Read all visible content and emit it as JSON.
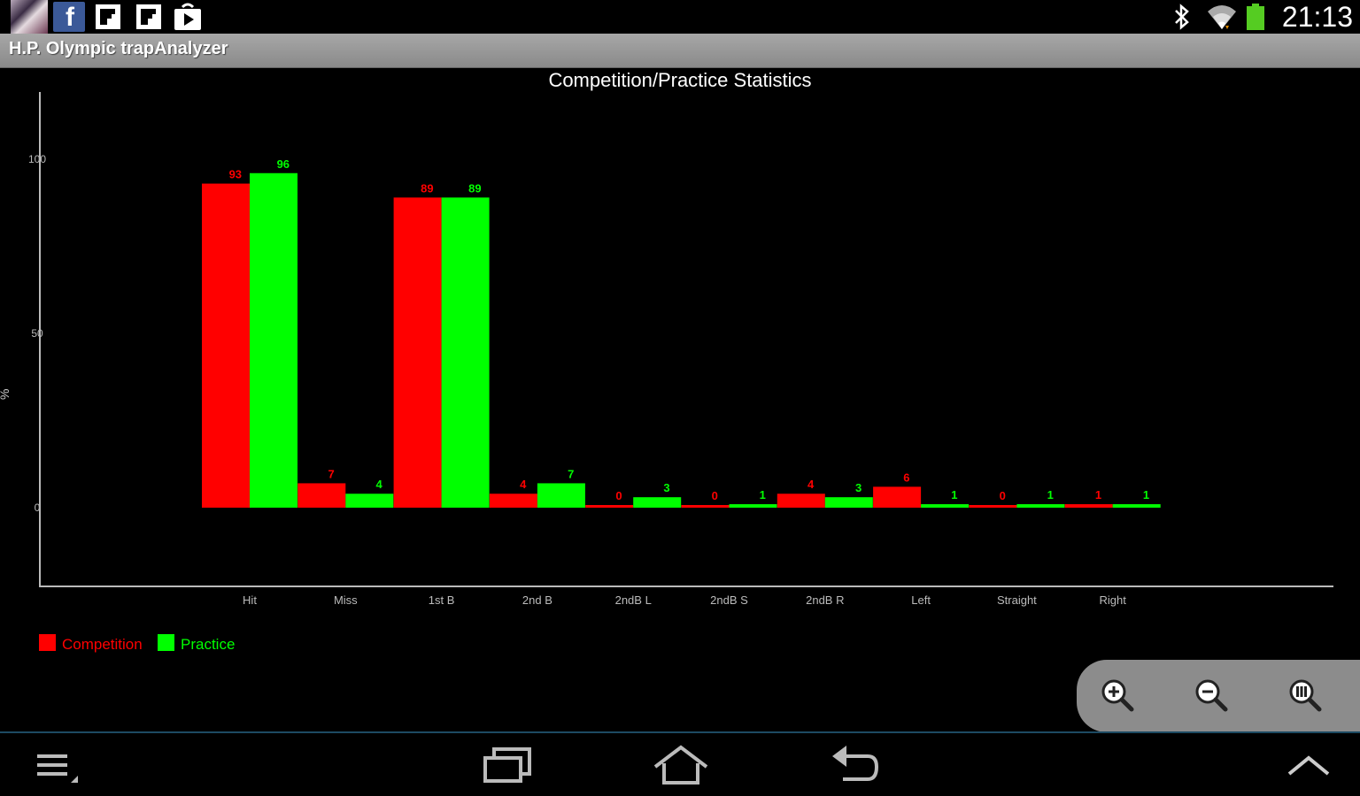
{
  "status_bar": {
    "time": "21:13",
    "icons": [
      "app-thumbnail-icon",
      "facebook-icon",
      "flipboard-icon",
      "flipboard-icon",
      "play-store-icon",
      "bluetooth-icon",
      "wifi-icon",
      "battery-icon"
    ]
  },
  "app": {
    "title": "H.P. Olympic trapAnalyzer"
  },
  "chart_data": {
    "type": "bar",
    "title": "Competition/Practice Statistics",
    "ylabel": "%",
    "xlabel": "",
    "ylim": [
      0,
      100
    ],
    "yticks": [
      "0",
      "50",
      "100"
    ],
    "categories": [
      "Hit",
      "Miss",
      "1st B",
      "2nd B",
      "2ndB L",
      "2ndB S",
      "2ndB R",
      "Left",
      "Straight",
      "Right"
    ],
    "series": [
      {
        "name": "Competition",
        "color": "#ff0000",
        "values": [
          93,
          7,
          89,
          4,
          0,
          0,
          4,
          6,
          0,
          1
        ]
      },
      {
        "name": "Practice",
        "color": "#00ff00",
        "values": [
          96,
          4,
          89,
          7,
          3,
          1,
          3,
          1,
          1,
          1
        ]
      }
    ],
    "grid": false,
    "legend_position": "bottom-left"
  },
  "zoom": {
    "icons": [
      "zoom-in-icon",
      "zoom-out-icon",
      "zoom-reset-icon"
    ]
  },
  "nav": {
    "icons": [
      "menu-icon",
      "recent-apps-icon",
      "home-icon",
      "back-icon",
      "chevron-up-icon"
    ]
  }
}
